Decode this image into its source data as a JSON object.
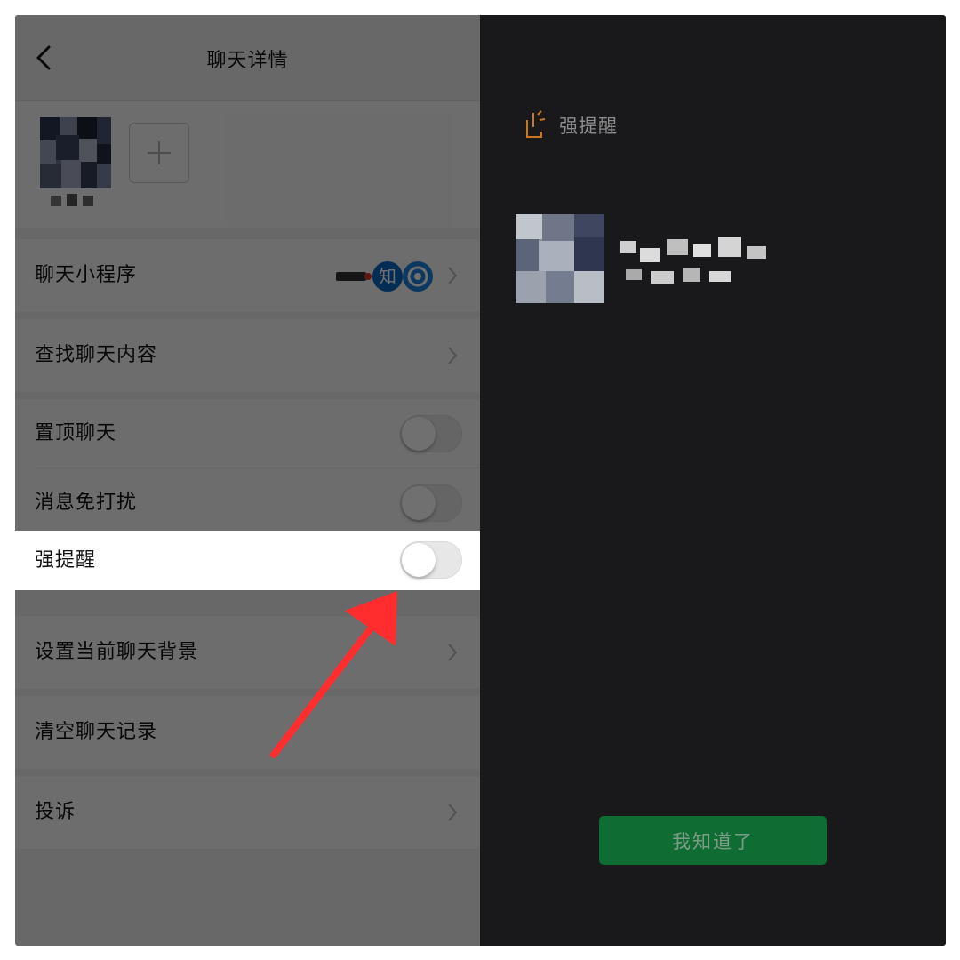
{
  "nav": {
    "title": "聊天详情"
  },
  "rows": {
    "mini_programs": "聊天小程序",
    "search_history": "查找聊天内容",
    "pin_chat": "置顶聊天",
    "mute": "消息免打扰",
    "strong_alert": "强提醒",
    "set_background": "设置当前聊天背景",
    "clear_history": "清空聊天记录",
    "report": "投诉"
  },
  "toggles": {
    "pin_chat": false,
    "mute": false,
    "strong_alert": false
  },
  "mini_program_icons": [
    "weixin-miniprogram-badge",
    "zhihu-icon",
    "eye-icon"
  ],
  "zhihu_glyph": "知",
  "right_panel": {
    "alert_title": "强提醒",
    "confirm_label": "我知道了"
  },
  "colors": {
    "confirm_bg": "#0f6d33",
    "alert_icon": "#c9781f",
    "zhihu_blue": "#0a66c2",
    "arrow_red": "#ff2d2d"
  }
}
